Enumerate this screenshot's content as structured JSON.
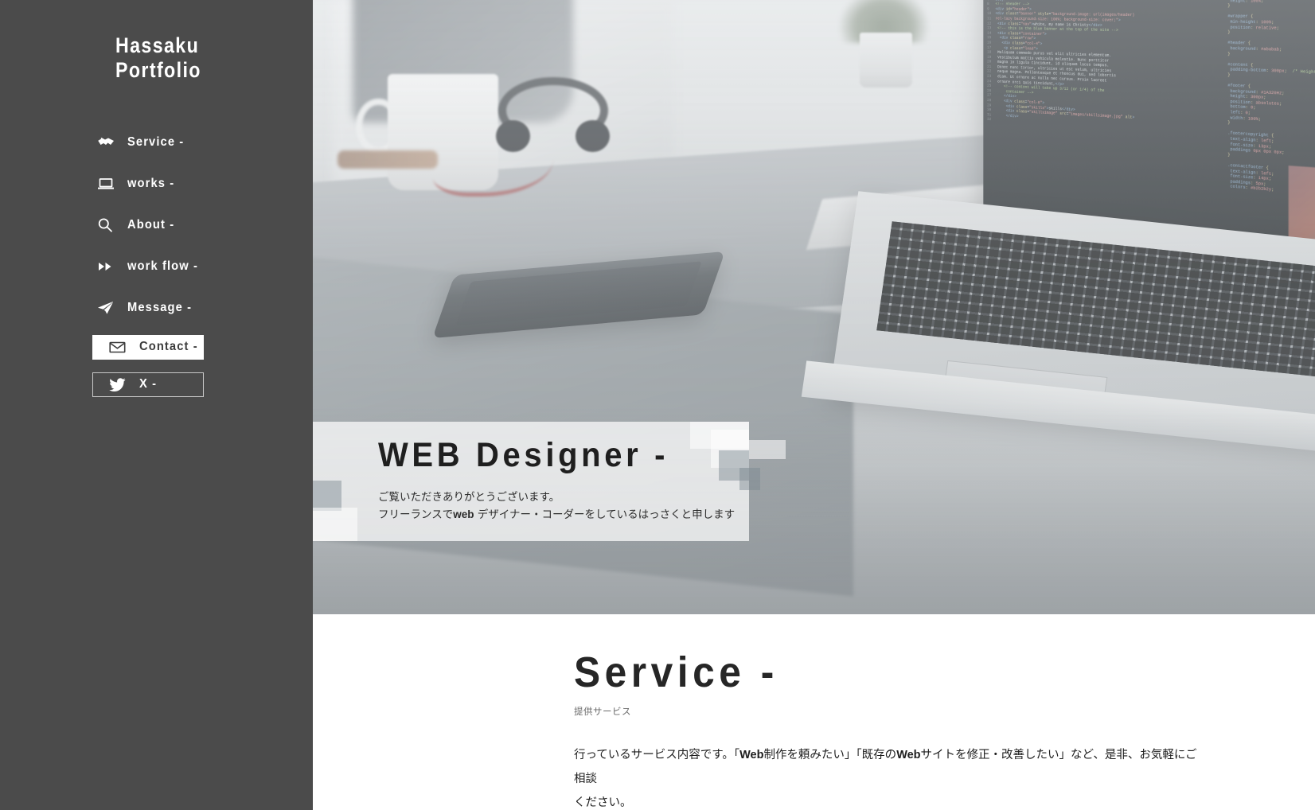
{
  "sidebar": {
    "logo_line1": "Hassaku",
    "logo_line2": "Portfolio",
    "items": [
      {
        "label": "Service -",
        "icon": "handshake-icon"
      },
      {
        "label": "works -",
        "icon": "laptop-icon"
      },
      {
        "label": "About -",
        "icon": "search-icon"
      },
      {
        "label": "work flow -",
        "icon": "fast-forward-icon"
      },
      {
        "label": "Message -",
        "icon": "paper-plane-icon"
      }
    ],
    "contact_button": {
      "label": "Contact -",
      "icon": "envelope-icon"
    },
    "x_button": {
      "label": "X -",
      "icon": "twitter-bird-icon"
    },
    "background_color": "#4b4b4b",
    "text_color": "#ffffff"
  },
  "hero": {
    "title": "WEB Designer -",
    "sub_line1": "ご覧いただきありがとうございます。",
    "sub_line2_pre": "フリーランスで",
    "sub_line2_web": "web",
    "sub_line2_post": " デザイナー・コーダーをしているはっさくと申します",
    "panel_color": "#ffffff"
  },
  "service": {
    "title": "Service -",
    "subtitle": "提供サービス",
    "body_1": "行っているサービス内容です。「",
    "body_web1": "Web",
    "body_2": "制作を頼みたい」「既存の",
    "body_web2": "Web",
    "body_3": "サイトを修正・改善したい」など、是非、お気軽にご相談",
    "body_4": "ください。"
  }
}
